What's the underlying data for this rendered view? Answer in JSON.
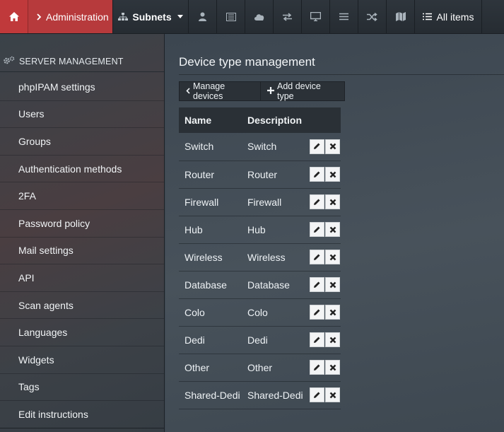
{
  "topnav": {
    "home_icon": "home-icon",
    "admin_label": "Administration",
    "subnets_label": "Subnets",
    "all_items_label": "All items",
    "colors": {
      "accent": "#c0393b",
      "bar": "#2b3137"
    }
  },
  "sidebar": {
    "header": "SERVER MANAGEMENT",
    "items": [
      {
        "label": "phpIPAM settings"
      },
      {
        "label": "Users"
      },
      {
        "label": "Groups"
      },
      {
        "label": "Authentication methods"
      },
      {
        "label": "2FA"
      },
      {
        "label": "Password policy"
      },
      {
        "label": "Mail settings"
      },
      {
        "label": "API"
      },
      {
        "label": "Scan agents"
      },
      {
        "label": "Languages"
      },
      {
        "label": "Widgets"
      },
      {
        "label": "Tags"
      },
      {
        "label": "Edit instructions"
      }
    ]
  },
  "main": {
    "title": "Device type management",
    "manage_devices_label": "Manage devices",
    "add_device_type_label": "Add device type",
    "table": {
      "headers": {
        "name": "Name",
        "description": "Description"
      },
      "rows": [
        {
          "name": "Switch",
          "description": "Switch"
        },
        {
          "name": "Router",
          "description": "Router"
        },
        {
          "name": "Firewall",
          "description": "Firewall"
        },
        {
          "name": "Hub",
          "description": "Hub"
        },
        {
          "name": "Wireless",
          "description": "Wireless"
        },
        {
          "name": "Database",
          "description": "Database"
        },
        {
          "name": "Colo",
          "description": "Colo"
        },
        {
          "name": "Dedi",
          "description": "Dedi"
        },
        {
          "name": "Other",
          "description": "Other"
        },
        {
          "name": "Shared-Dedi",
          "description": "Shared-Dedi"
        }
      ]
    }
  }
}
